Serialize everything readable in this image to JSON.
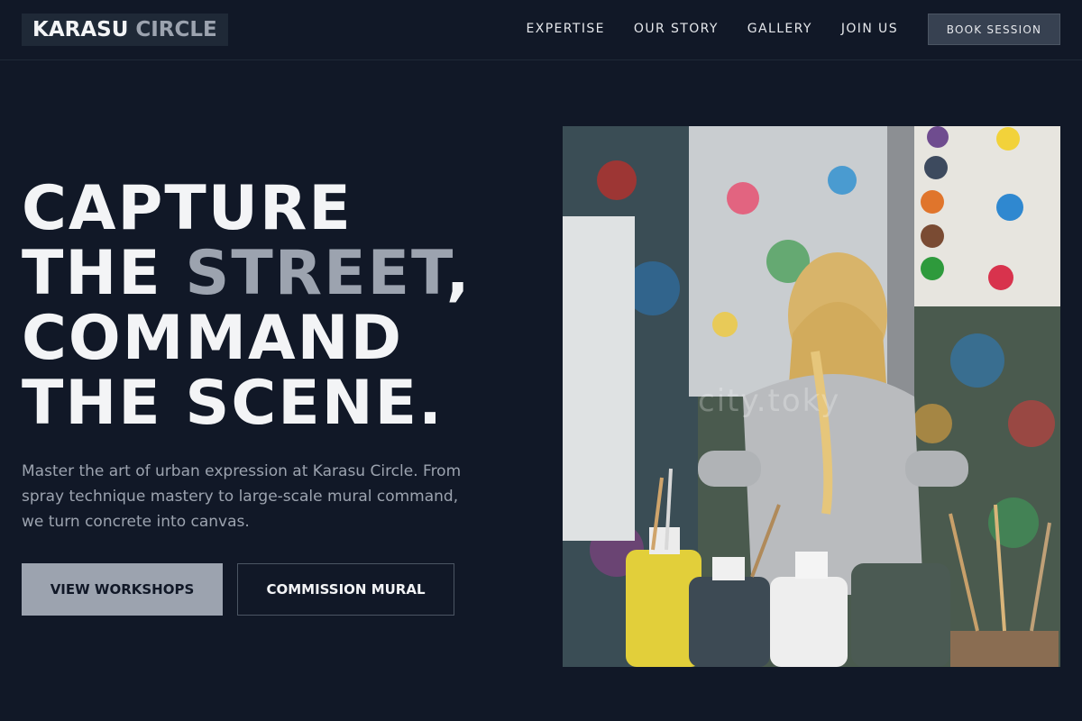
{
  "brand": {
    "name_part1": "KARASU",
    "name_part2": "CIRCLE"
  },
  "nav": {
    "links": [
      "EXPERTISE",
      "OUR STORY",
      "GALLERY",
      "JOIN US"
    ],
    "cta": "BOOK SESSION"
  },
  "hero": {
    "headline_line1": "CAPTURE",
    "headline_line2_a": "THE ",
    "headline_line2_highlight": "STREET",
    "headline_line2_b": ",",
    "headline_line3": "COMMAND",
    "headline_line4": "THE SCENE.",
    "description": "Master the art of urban expression at Karasu Circle. From spray technique mastery to large-scale mural command, we turn concrete into canvas.",
    "primary_button": "VIEW WORKSHOPS",
    "secondary_button": "COMMISSION MURAL",
    "image_watermark": "city.toky"
  },
  "colors": {
    "background": "#111827",
    "text": "#f3f4f6",
    "accent_muted": "#9ca3af",
    "cta_background": "#374151"
  }
}
